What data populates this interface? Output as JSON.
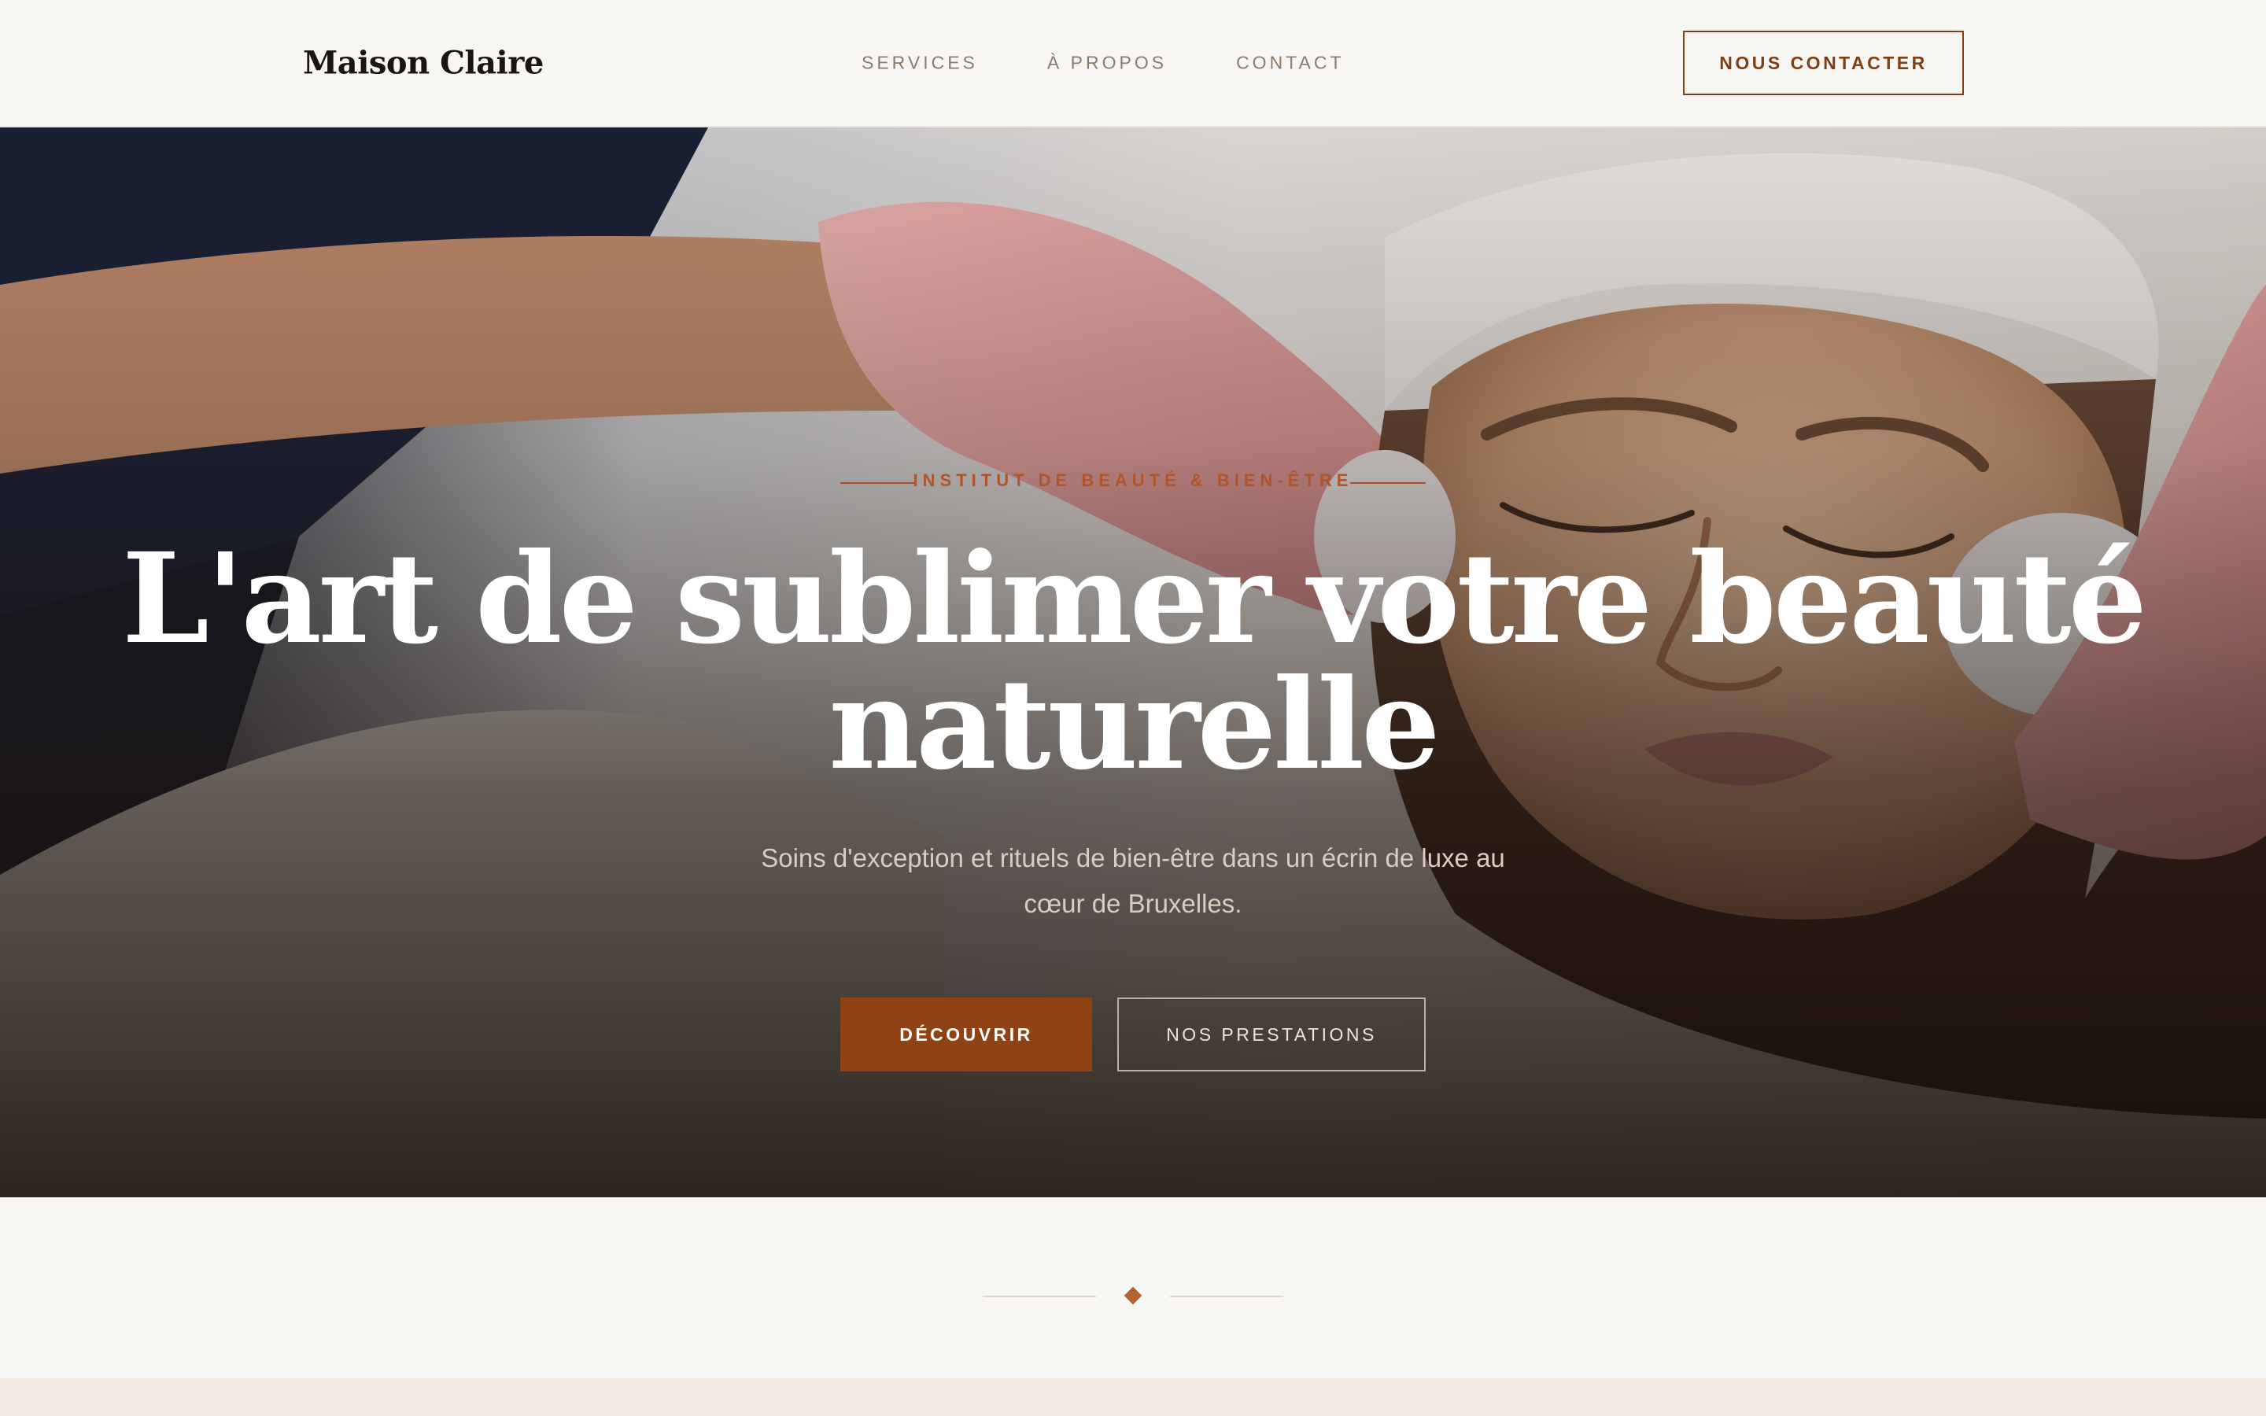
{
  "header": {
    "logo": "Maison Claire",
    "nav": [
      "SERVICES",
      "À PROPOS",
      "CONTACT"
    ],
    "cta": "NOUS CONTACTER"
  },
  "hero": {
    "eyebrow": "INSTITUT DE BEAUTÉ & BIEN-ÊTRE",
    "title_line1": "L'art de sublimer votre beauté",
    "title_line2": "naturelle",
    "subtitle": "Soins d'exception et rituels de bien-être dans un écrin de luxe au cœur de Bruxelles.",
    "primary_button": "DÉCOUVRIR",
    "secondary_button": "NOS PRESTATIONS"
  },
  "colors": {
    "accent": "#8f4314",
    "background": "#f8f6f2",
    "text_dark": "#1b1510"
  }
}
